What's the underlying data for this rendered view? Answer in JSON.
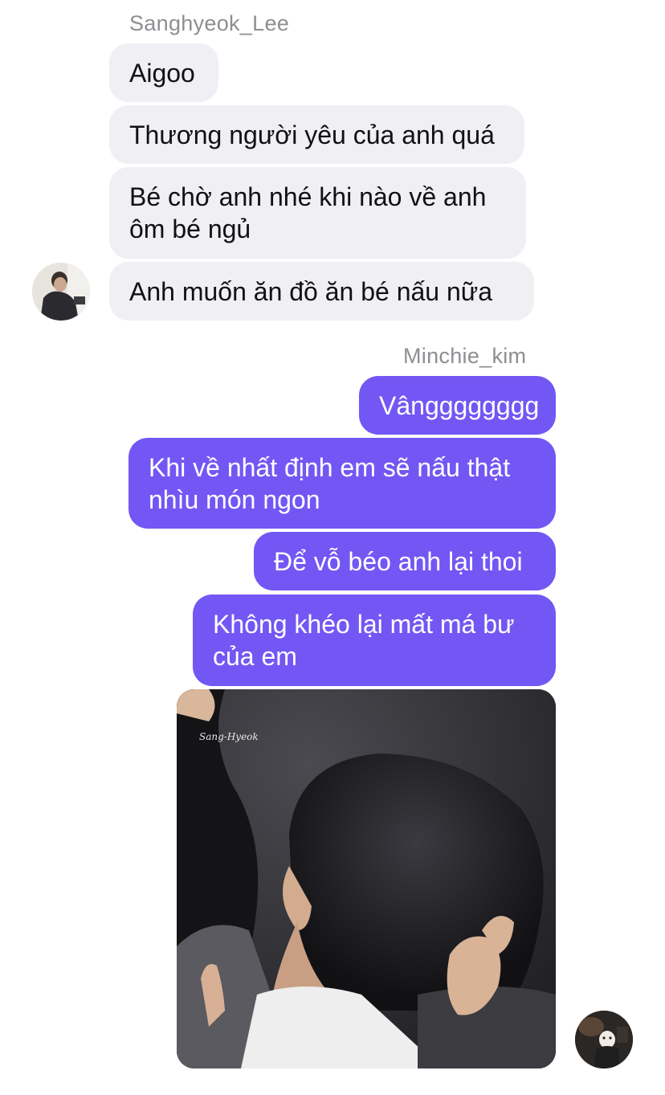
{
  "conversation": {
    "incoming": {
      "sender_name": "Sanghyeok_Lee",
      "messages": [
        {
          "text": "Aigoo"
        },
        {
          "text": "Thương người yêu của anh quá"
        },
        {
          "text": "Bé chờ anh nhé khi nào về anh\nôm bé ngủ"
        },
        {
          "text": "Anh muốn ăn đồ ăn bé nấu nữa"
        }
      ]
    },
    "outgoing": {
      "sender_name": "Minchie_kim",
      "messages": [
        {
          "text": "Vângggggggg"
        },
        {
          "text": "Khi về nhất định em sẽ nấu thật\nnhìu món ngon"
        },
        {
          "text": "Để vỗ béo anh lại thoi"
        },
        {
          "text": "Không khéo lại mất má bư\ncủa em"
        }
      ],
      "photo": {
        "watermark": "Sang-Hyeok"
      }
    }
  },
  "colors": {
    "incoming_bubble": "#efeff4",
    "outgoing_bubble": "#7357f4",
    "sender_name": "#8e8e93"
  }
}
